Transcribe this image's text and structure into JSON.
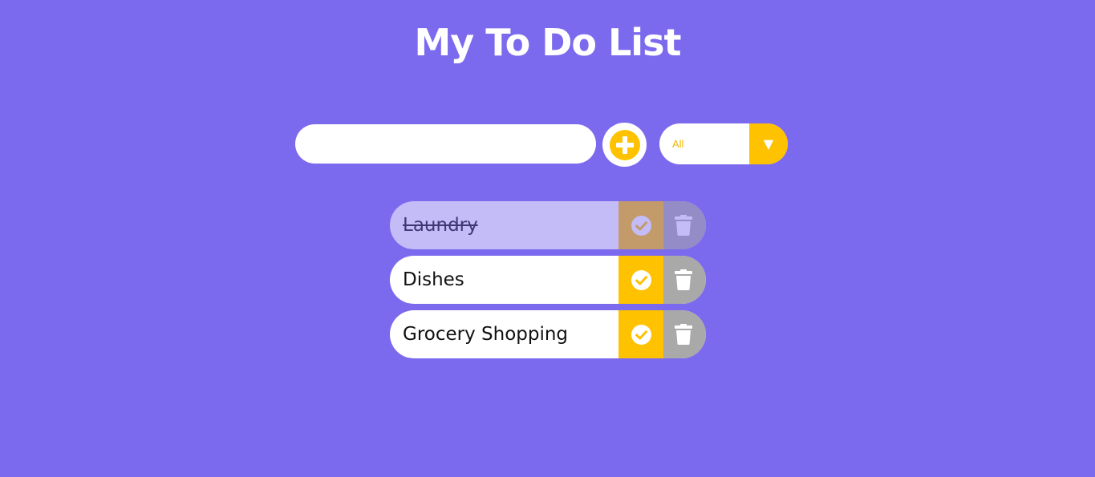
{
  "app": {
    "title": "My To Do List"
  },
  "form": {
    "input_value": "",
    "input_placeholder": "",
    "add_icon": "plus-circle-icon",
    "filter_selected": "All",
    "filter_arrow": "▼"
  },
  "todos": [
    {
      "text": "Laundry",
      "completed": true
    },
    {
      "text": "Dishes",
      "completed": false
    },
    {
      "text": "Grocery Shopping",
      "completed": false
    }
  ],
  "icons": {
    "complete": "check-circle-icon",
    "delete": "trash-icon"
  },
  "colors": {
    "background": "#7b6aee",
    "accent": "#ffc200",
    "delete": "#a9a9a9",
    "text": "#111111",
    "white": "#ffffff"
  }
}
